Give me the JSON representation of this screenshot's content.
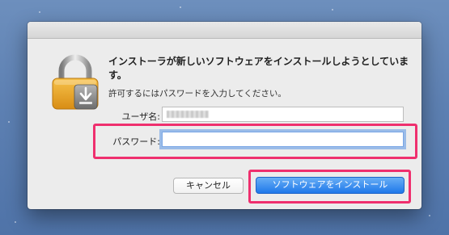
{
  "dialog": {
    "heading": "インストーラが新しいソフトウェアをインストールしようとしています。",
    "subtext": "許可するにはパスワードを入力してください。",
    "username_label": "ユーザ名:",
    "password_label": "パスワード:",
    "password_value": "",
    "cancel_label": "キャンセル",
    "install_label": "ソフトウェアをインストール"
  },
  "icons": {
    "lock": "lock-icon"
  },
  "colors": {
    "highlight": "#ef2f6e",
    "install_button": "#1f78ea",
    "dialog_background": "#ececec"
  }
}
